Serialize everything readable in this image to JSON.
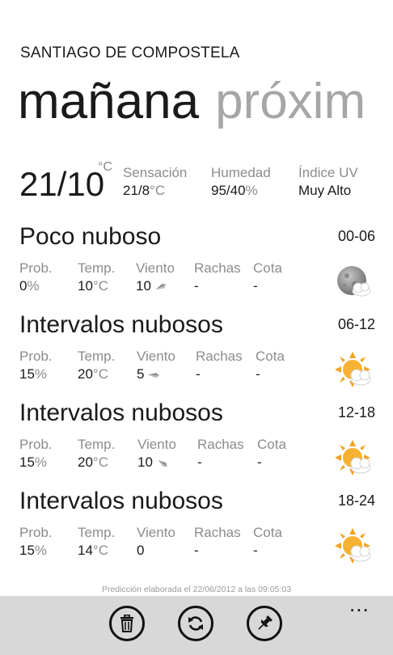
{
  "app": {
    "city": "SANTIAGO DE COMPOSTELA"
  },
  "pivot": {
    "active": "mañana",
    "next": "próxim"
  },
  "summary": {
    "temp": "21/10",
    "temp_unit": "°C",
    "sensacion_label": "Sensación",
    "sensacion_value": "21/8",
    "sensacion_unit": "°C",
    "humedad_label": "Humedad",
    "humedad_value": "95/40",
    "humedad_unit": "%",
    "uv_label": "Índice UV",
    "uv_value": "Muy Alto"
  },
  "labels": {
    "prob": "Prob.",
    "temp": "Temp.",
    "viento": "Viento",
    "rachas": "Rachas",
    "cota": "Cota",
    "percent": "%",
    "celsius": "°C"
  },
  "periods": [
    {
      "condition": "Poco nuboso",
      "hours": "00-06",
      "prob": "0",
      "temp": "10",
      "wind": "10",
      "rachas": "-",
      "cota": "-",
      "icon": "moon-cloud-icon"
    },
    {
      "condition": "Intervalos nubosos",
      "hours": "06-12",
      "prob": "15",
      "temp": "20",
      "wind": "5",
      "rachas": "-",
      "cota": "-",
      "icon": "sun-cloud-icon"
    },
    {
      "condition": "Intervalos nubosos",
      "hours": "12-18",
      "prob": "15",
      "temp": "20",
      "wind": "10",
      "rachas": "-",
      "cota": "-",
      "icon": "sun-cloud-icon"
    },
    {
      "condition": "Intervalos nubosos",
      "hours": "18-24",
      "prob": "15",
      "temp": "14",
      "wind": "0",
      "rachas": "-",
      "cota": "-",
      "icon": "sun-cloud-icon"
    }
  ],
  "footer": {
    "note": "Predicción elaborada el 22/06/2012 a las 09:05:03"
  },
  "appbar": {
    "more": "..."
  },
  "colors": {
    "accent": "#f6a21e",
    "appbar": "#d8d8d8",
    "muted": "#8c8c8c"
  }
}
